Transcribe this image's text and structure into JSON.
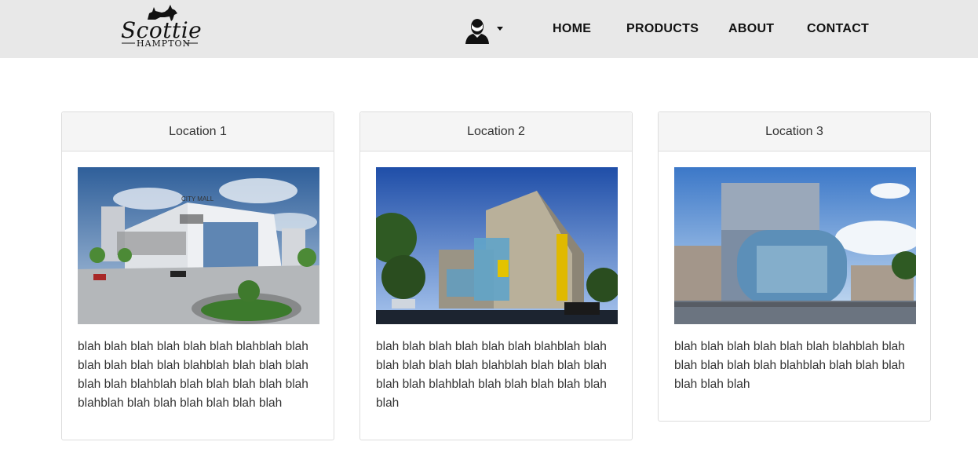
{
  "brand": {
    "name": "Scottie",
    "sub": "HAMPTON"
  },
  "nav": {
    "user_icon": "user-avatar-icon",
    "links": [
      {
        "label": "HOME"
      },
      {
        "label": "PRODUCTS"
      },
      {
        "label": "ABOUT"
      },
      {
        "label": "CONTACT"
      }
    ]
  },
  "locations": [
    {
      "title": "Location 1",
      "sign": "CITY MALL",
      "text": "blah blah blah blah blah blah blahblah blah blah blah blah blah blahblah blah blah blah blah blah blahblah blah blah blah blah blah blahblah blah blah blah blah blah blah"
    },
    {
      "title": "Location 2",
      "text": "blah blah blah blah blah blah blahblah blah blah blah blah blah blahblah blah blah blah blah blah blahblah blah blah blah blah blah blah"
    },
    {
      "title": "Location 3",
      "text": "blah blah blah blah blah blah blahblah blah blah blah blah blah blahblah blah blah blah blah blah blah"
    }
  ],
  "colors": {
    "navbar_bg": "#e8e8e8",
    "card_header_bg": "#f5f5f5",
    "border": "#dddddd",
    "text": "#333333"
  }
}
